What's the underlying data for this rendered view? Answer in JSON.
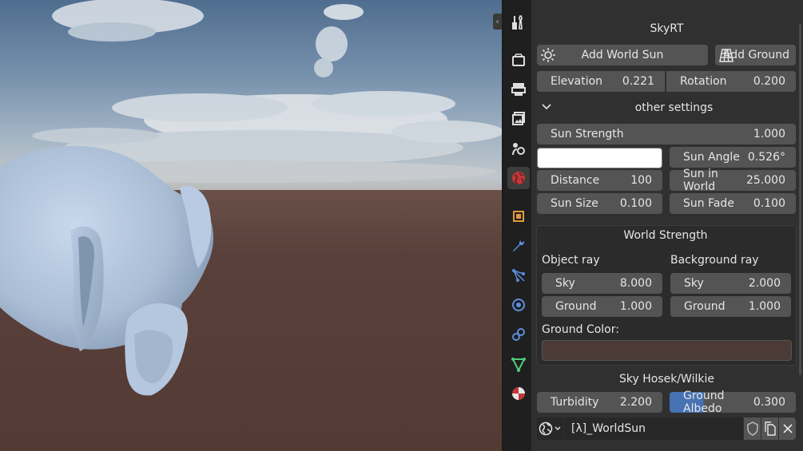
{
  "panel": {
    "title": "SkyRT",
    "add_world_sun": "Add World Sun",
    "add_ground": "Add Ground",
    "elevation": {
      "label": "Elevation",
      "value": "0.221"
    },
    "rotation": {
      "label": "Rotation",
      "value": "0.200"
    },
    "other_settings": "other settings",
    "sun_strength": {
      "label": "Sun  Strength",
      "value": "1.000"
    },
    "sun_color": "#ffffff",
    "sun_angle": {
      "label": "Sun  Angle",
      "value": "0.526°"
    },
    "distance": {
      "label": "Distance",
      "value": "100"
    },
    "sun_in_world": {
      "label": "Sun in World",
      "value": "25.000"
    },
    "sun_size": {
      "label": "Sun Size",
      "value": "0.100"
    },
    "sun_fade": {
      "label": "Sun Fade",
      "value": "0.100"
    },
    "world_strength": {
      "title": "World Strength",
      "object_ray": "Object ray",
      "background_ray": "Background ray",
      "obj_sky": {
        "label": "Sky",
        "value": "8.000"
      },
      "obj_ground": {
        "label": "Ground",
        "value": "1.000"
      },
      "bg_sky": {
        "label": "Sky",
        "value": "2.000"
      },
      "bg_ground": {
        "label": "Ground",
        "value": "1.000"
      },
      "ground_color_label": "Ground Color:",
      "ground_color": "#4b3a35"
    },
    "sky_model": "Sky Hosek/Wilkie",
    "turbidity": {
      "label": "Turbidity",
      "value": "2.200"
    },
    "ground_albedo": {
      "label": "Ground Albedo",
      "value": "0.300",
      "fill": 0.3
    },
    "world_name": "[λ]_WorldSun"
  },
  "tabs": [
    "tool-icon",
    "render-icon",
    "output-icon",
    "view-layer-icon",
    "scene-icon",
    "world-icon",
    "object-icon",
    "modifier-icon",
    "particles-icon",
    "physics-icon",
    "constraints-icon",
    "data-icon",
    "material-icon"
  ],
  "colors": {
    "selected": "#4772b3",
    "field": "#545454",
    "panel": "#303030"
  }
}
